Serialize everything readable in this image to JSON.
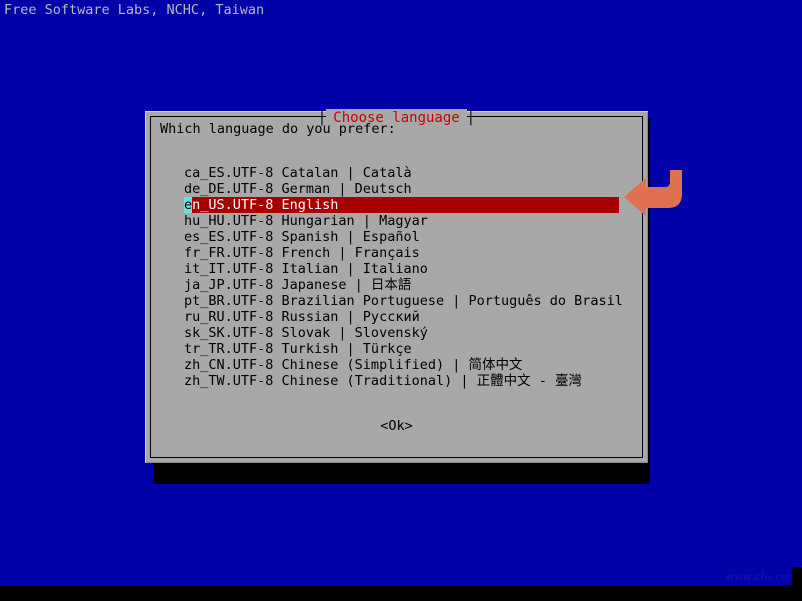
{
  "screen": {
    "background_color": "#0000a8",
    "banner_text": "Free Software Labs, NCHC, Taiwan",
    "banner_color": "#b8b8c8",
    "watermark": "www.cfu.com"
  },
  "dialog": {
    "title": "Choose language",
    "title_color": "#cc0000",
    "background_color": "#a8a8a8",
    "prompt": "Which language do you prefer:",
    "ok_label": "<Ok>",
    "selection_bg_color": "#a80000",
    "selection_fg_color": "#ffffff",
    "cursor_color": "#6ae0e0"
  },
  "languages": [
    {
      "locale": "ca_ES.UTF-8",
      "english": "Catalan",
      "native": "| Català",
      "selected": false
    },
    {
      "locale": "de_DE.UTF-8",
      "english": "German",
      "native": "| Deutsch",
      "selected": false
    },
    {
      "locale": "en_US.UTF-8",
      "english": "English",
      "native": "",
      "selected": true
    },
    {
      "locale": "hu_HU.UTF-8",
      "english": "Hungarian",
      "native": "| Magyar",
      "selected": false
    },
    {
      "locale": "es_ES.UTF-8",
      "english": "Spanish",
      "native": "| Español",
      "selected": false
    },
    {
      "locale": "fr_FR.UTF-8",
      "english": "French",
      "native": "| Français",
      "selected": false
    },
    {
      "locale": "it_IT.UTF-8",
      "english": "Italian",
      "native": "| Italiano",
      "selected": false
    },
    {
      "locale": "ja_JP.UTF-8",
      "english": "Japanese",
      "native": "| 日本語",
      "selected": false
    },
    {
      "locale": "pt_BR.UTF-8",
      "english": "Brazilian Portuguese",
      "native": "| Português do Brasil",
      "selected": false
    },
    {
      "locale": "ru_RU.UTF-8",
      "english": "Russian",
      "native": "| Русский",
      "selected": false
    },
    {
      "locale": "sk_SK.UTF-8",
      "english": "Slovak",
      "native": "| Slovenský",
      "selected": false
    },
    {
      "locale": "tr_TR.UTF-8",
      "english": "Turkish",
      "native": "| Türkçe",
      "selected": false
    },
    {
      "locale": "zh_CN.UTF-8",
      "english": "Chinese (Simplified)",
      "native": "| 简体中文",
      "selected": false
    },
    {
      "locale": "zh_TW.UTF-8",
      "english": "Chinese (Traditional)",
      "native": "| 正體中文 - 臺灣",
      "selected": false
    }
  ],
  "annotation": {
    "arrow_color": "#e07050",
    "arrow_name": "curved-left-arrow"
  }
}
